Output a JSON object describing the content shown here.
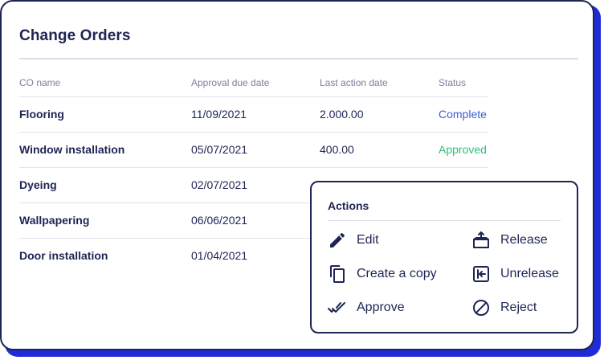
{
  "page": {
    "title": "Change Orders"
  },
  "table": {
    "headers": [
      "CO name",
      "Approval due date",
      "Last action date",
      "Status"
    ],
    "rows": [
      {
        "name": "Flooring",
        "approval_due": "11/09/2021",
        "last_action": "2.000.00",
        "status": "Complete"
      },
      {
        "name": "Window installation",
        "approval_due": "05/07/2021",
        "last_action": "400.00",
        "status": "Approved"
      },
      {
        "name": "Dyeing",
        "approval_due": "02/07/2021",
        "last_action": "",
        "status": ""
      },
      {
        "name": "Wallpapering",
        "approval_due": "06/06/2021",
        "last_action": "",
        "status": ""
      },
      {
        "name": "Door installation",
        "approval_due": "01/04/2021",
        "last_action": "",
        "status": ""
      }
    ]
  },
  "actions_menu": {
    "title": "Actions",
    "items": [
      {
        "label": "Edit",
        "icon": "pencil-icon"
      },
      {
        "label": "Release",
        "icon": "release-icon"
      },
      {
        "label": "Create a copy",
        "icon": "copy-icon"
      },
      {
        "label": "Unrelease",
        "icon": "unrelease-icon"
      },
      {
        "label": "Approve",
        "icon": "double-check-icon"
      },
      {
        "label": "Reject",
        "icon": "block-icon"
      }
    ]
  },
  "colors": {
    "text_dark": "#1e2454",
    "status_complete": "#3c5bd6",
    "status_approved": "#2fbf7a",
    "card_shadow": "#1f2bd6"
  }
}
